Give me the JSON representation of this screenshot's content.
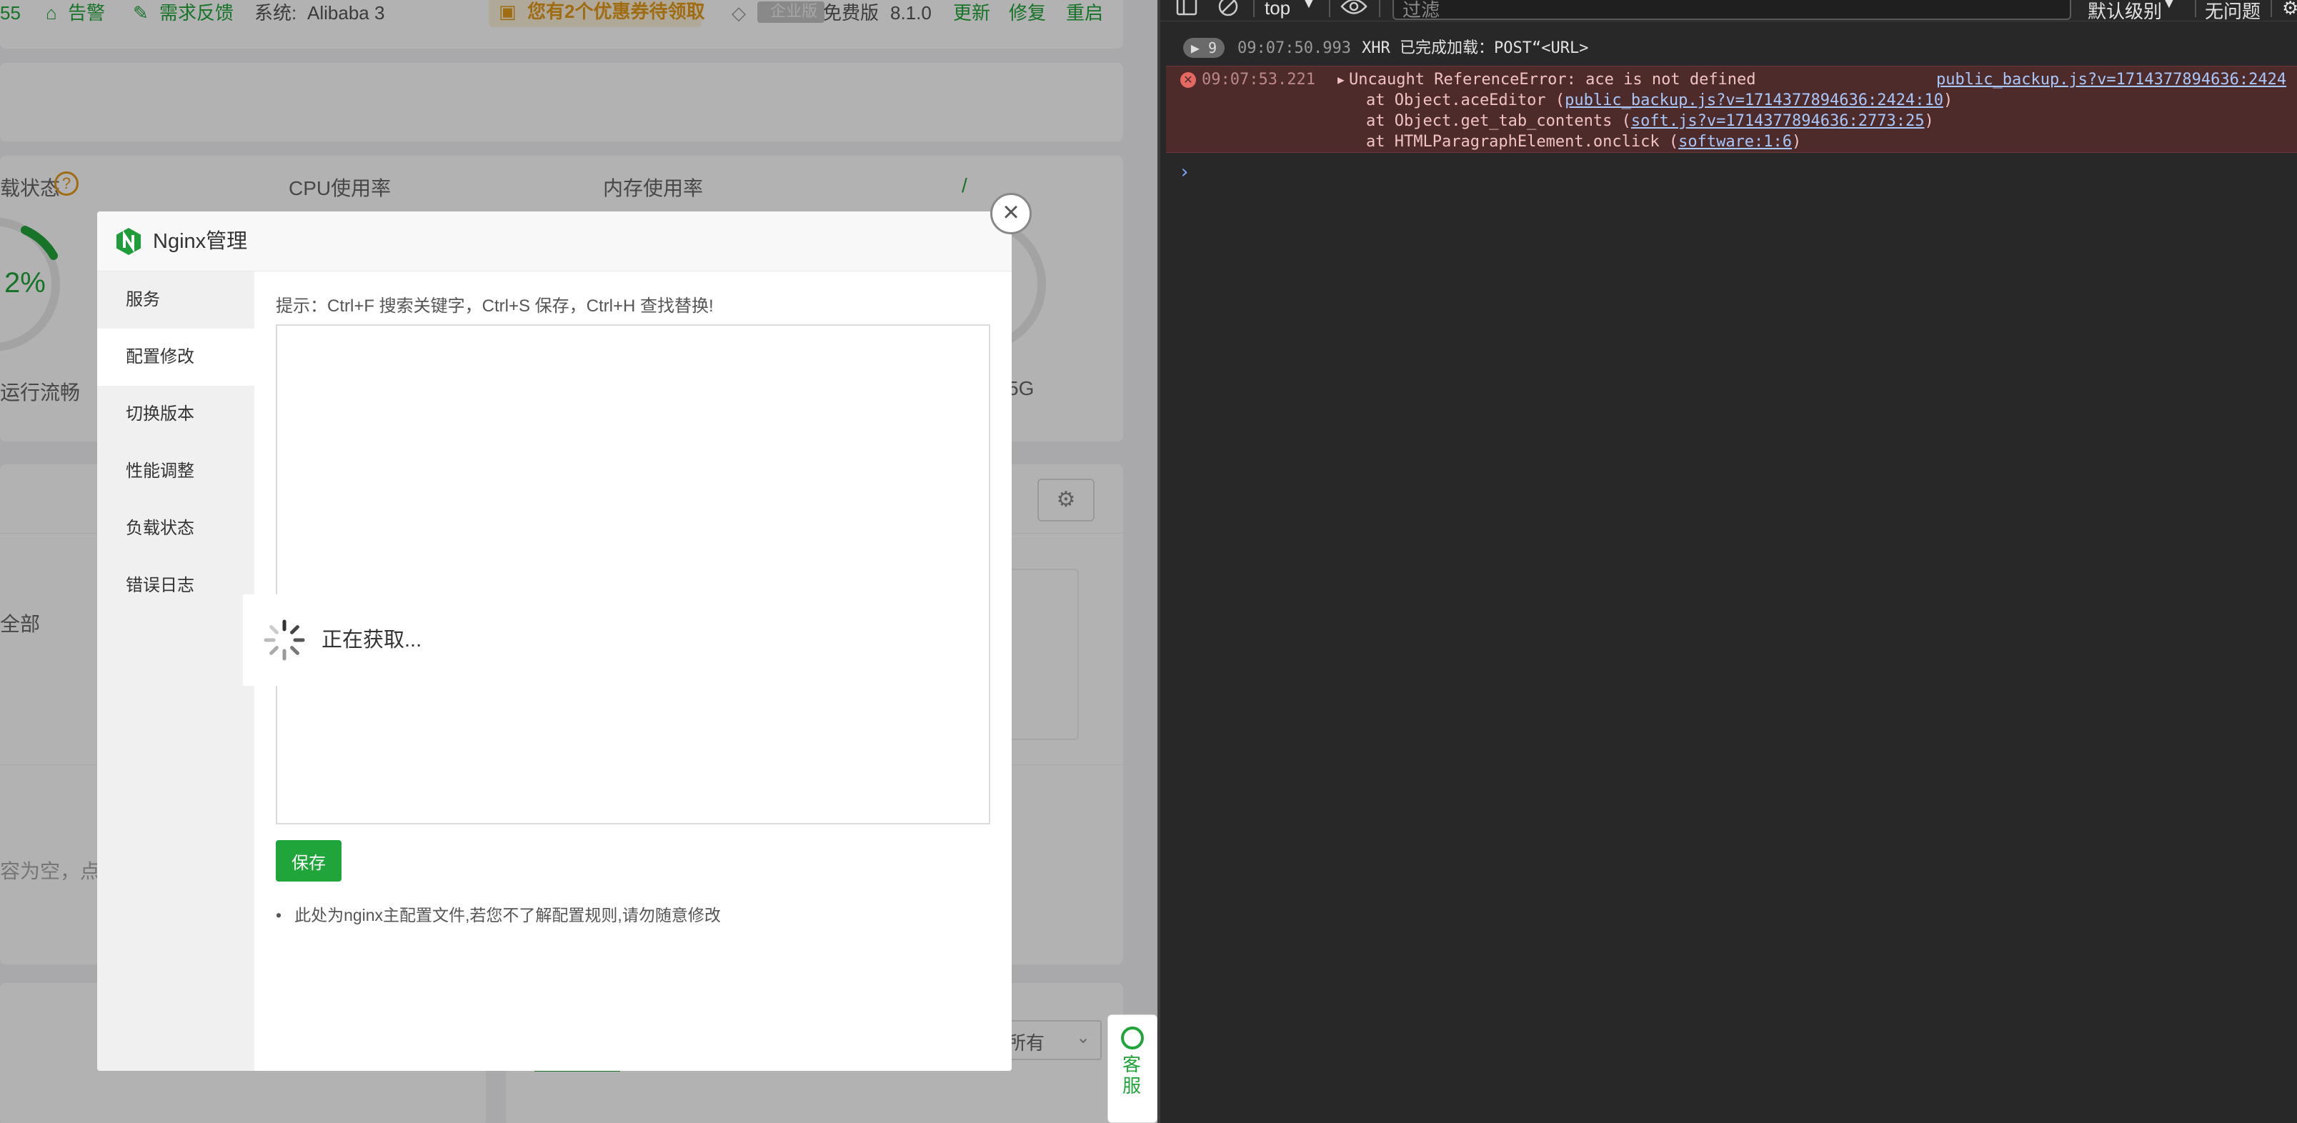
{
  "topbar": {
    "partial_number": "55",
    "alert_label": "告警",
    "feedback_label": "需求反馈",
    "system_label": "系统:",
    "system_value": "Alibaba 3",
    "promo_text": "您有2个优惠券待领取",
    "enterprise_label": "企业版",
    "edition_label": "免费版",
    "version": "8.1.0",
    "update_label": "更新",
    "repair_label": "修复",
    "restart_label": "重启"
  },
  "background": {
    "load_status_label": "载状态",
    "cpu_label": "CPU使用率",
    "memory_label": "内存使用率",
    "slash": "/",
    "percent_value": "2%",
    "run_status": "运行流畅",
    "disk_suffix": "5G",
    "all_label": "全部",
    "empty_text": "容为空，点击",
    "select_value": "所有"
  },
  "dialog": {
    "title": "Nginx管理",
    "close_glyph": "×",
    "sidebar": [
      {
        "label": "服务",
        "active": false
      },
      {
        "label": "配置修改",
        "active": true
      },
      {
        "label": "切换版本",
        "active": false
      },
      {
        "label": "性能调整",
        "active": false
      },
      {
        "label": "负载状态",
        "active": false
      },
      {
        "label": "错误日志",
        "active": false
      }
    ],
    "hint": "提示：Ctrl+F 搜索关键字，Ctrl+S 保存，Ctrl+H 查找替换!",
    "save_label": "保存",
    "note": "此处为nginx主配置文件,若您不了解配置规则,请勿随意修改"
  },
  "loading": {
    "text": "正在获取..."
  },
  "support": {
    "label": "客服"
  },
  "devtools": {
    "context": "top",
    "filter_placeholder": "过滤",
    "level": "默认级别",
    "issues": "无问题",
    "log_count": "9",
    "xhr_time": "09:07:50.993",
    "xhr_message": "XHR 已完成加载：POST“<URL>",
    "error": {
      "time": "09:07:53.221",
      "message": "Uncaught ReferenceError: ace is not defined",
      "source": "public_backup.js?v=1714377894636:2424",
      "stack": [
        {
          "prefix": "at Object.aceEditor (",
          "link": "public_backup.js?v=1714377894636:2424:10",
          "suffix": ")"
        },
        {
          "prefix": "at Object.get_tab_contents (",
          "link": "soft.js?v=1714377894636:2773:25",
          "suffix": ")"
        },
        {
          "prefix": "at HTMLParagraphElement.onclick (",
          "link": "software:1:6",
          "suffix": ")"
        }
      ]
    },
    "prompt_glyph": "›"
  }
}
